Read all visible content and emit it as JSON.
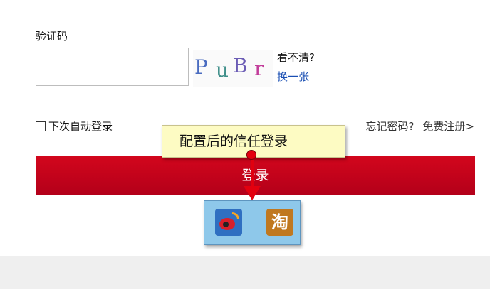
{
  "captcha_section": {
    "label": "验证码",
    "input_value": "",
    "captcha_text": "PuBr",
    "unclear_text": "看不清?",
    "refresh_link": "换一张"
  },
  "options": {
    "remember_label": "下次自动登录",
    "remember_checked": false,
    "forgot_link": "忘记密码?",
    "register_link": "免费注册>"
  },
  "login_button": {
    "label": "登录"
  },
  "tooltip": {
    "text": "配置后的信任登录"
  },
  "third_party": {
    "weibo_icon": "weibo-icon",
    "taobao_icon": "taobao-icon",
    "taobao_glyph": "淘"
  },
  "colors": {
    "primary_red": "#c8001a",
    "link_blue": "#1a4fb3",
    "tooltip_bg": "#fdfbc3",
    "panel_blue": "#8ec8ea"
  }
}
